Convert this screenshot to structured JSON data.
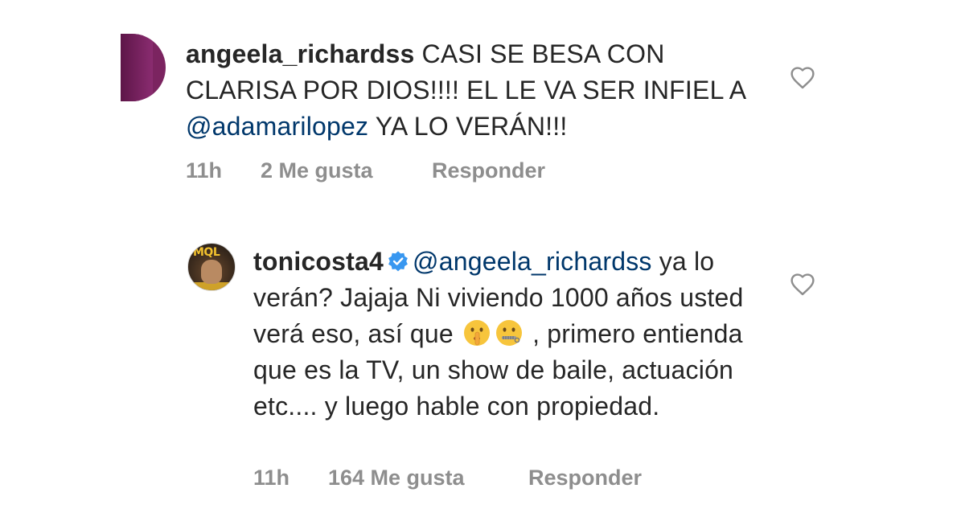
{
  "comments": [
    {
      "username": "angeela_richardss",
      "text_before": " CASI SE BESA CON CLARISA POR DIOS!!!! EL LE VA SER INFIEL A ",
      "mention": "@adamarilopez",
      "text_after": " YA LO VERÁN!!!",
      "time": "11h",
      "likes": "2 Me gusta",
      "reply": "Responder",
      "avatar_icon": "avatar-purple",
      "like_icon": "heart-outline-icon"
    },
    {
      "username": "tonicosta4",
      "verified_icon": "verified-badge-icon",
      "mention": "@angeela_richardss",
      "text_part1": " ya lo verán? Jajaja Ni viviendo 1000 años usted verá eso, así que ",
      "emoji1": "shushing-face-emoji",
      "emoji2": "zipper-mouth-face-emoji",
      "text_part2": " , primero entienda que es la TV, un show de baile, actuación etc.... y luego hable con propiedad.",
      "time": "11h",
      "likes": "164 Me gusta",
      "reply": "Responder",
      "avatar_text": "MQL",
      "like_icon": "heart-outline-icon"
    }
  ],
  "colors": {
    "text": "#262626",
    "mention": "#00376b",
    "meta": "#8e8e8e",
    "verified": "#3897f0",
    "heart_stroke": "#8e8e8e"
  }
}
